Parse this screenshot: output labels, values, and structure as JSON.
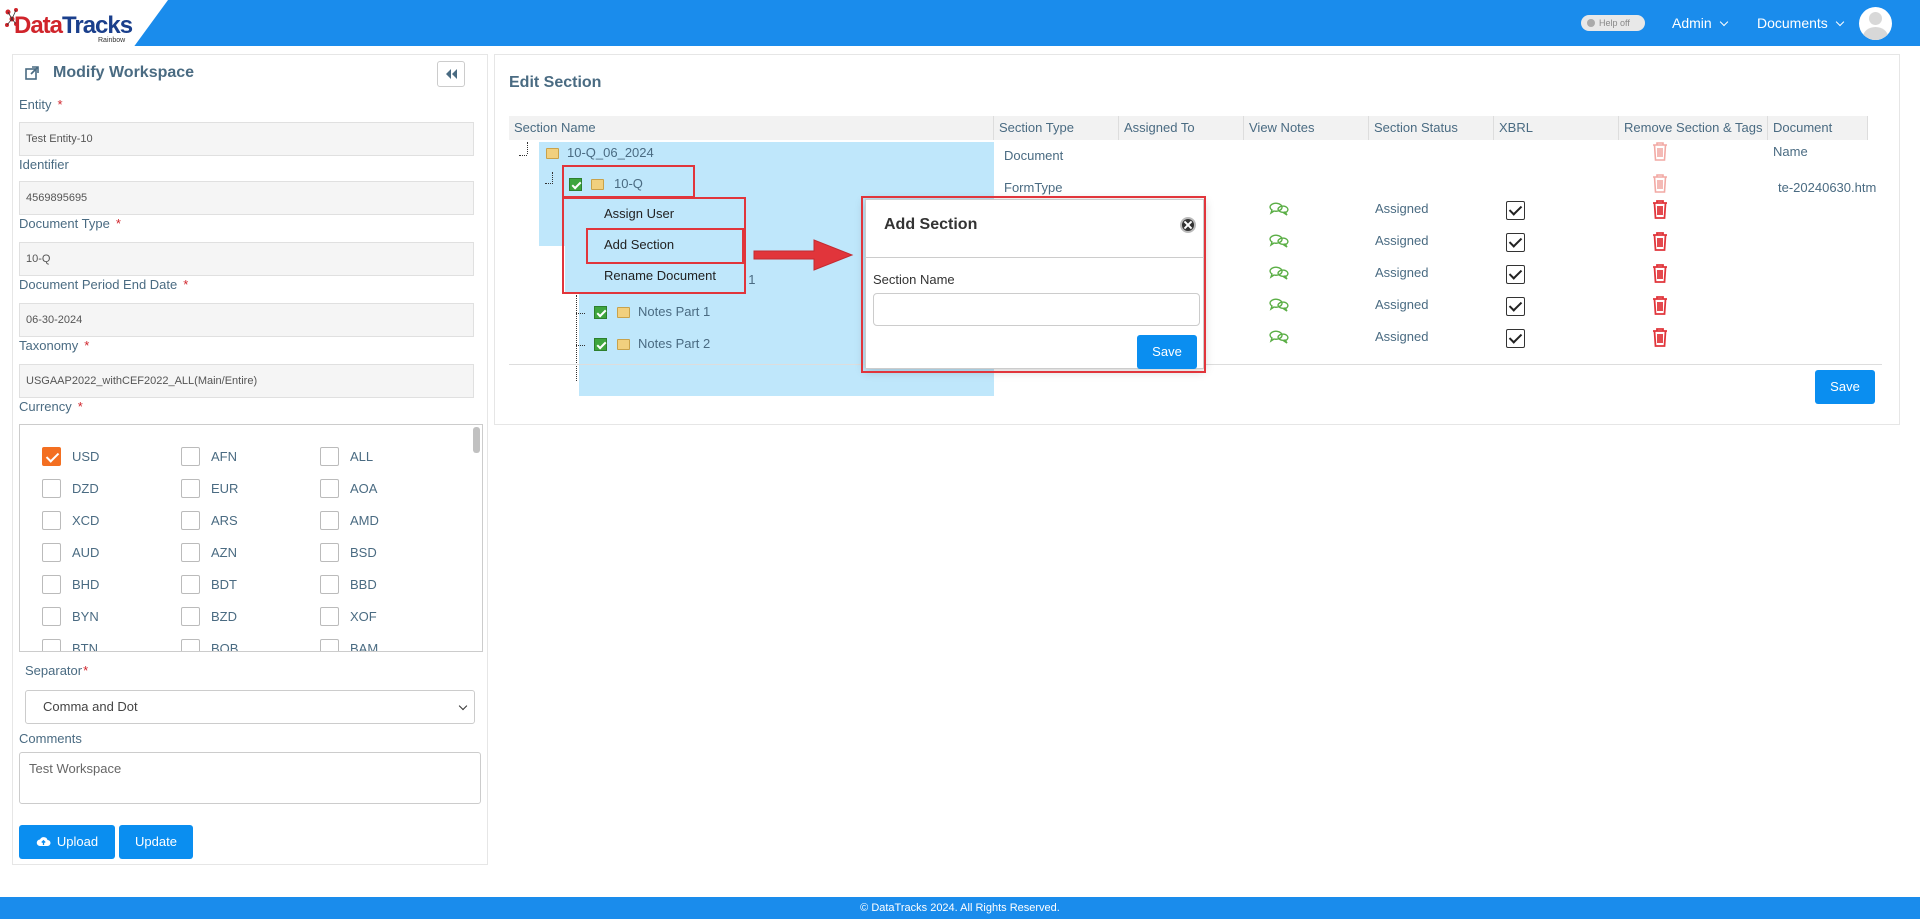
{
  "header": {
    "logo_text_a": "Data",
    "logo_text_b": "Tracks",
    "logo_sub": "Rainbow",
    "help_label": "Help off",
    "nav_admin": "Admin",
    "nav_documents": "Documents"
  },
  "left": {
    "title": "Modify Workspace",
    "entity_label": "Entity",
    "entity_value": "Test Entity-10",
    "identifier_label": "Identifier",
    "identifier_value": "4569895695",
    "doctype_label": "Document Type",
    "doctype_value": "10-Q",
    "period_label": "Document Period End Date",
    "period_value": "06-30-2024",
    "taxonomy_label": "Taxonomy",
    "taxonomy_value": "USGAAP2022_withCEF2022_ALL(Main/Entire)",
    "currency_label": "Currency",
    "currencies": [
      [
        "USD",
        "AFN",
        "ALL"
      ],
      [
        "DZD",
        "EUR",
        "AOA"
      ],
      [
        "XCD",
        "ARS",
        "AMD"
      ],
      [
        "AUD",
        "AZN",
        "BSD"
      ],
      [
        "BHD",
        "BDT",
        "BBD"
      ],
      [
        "BYN",
        "BZD",
        "XOF"
      ],
      [
        "BTN",
        "BOB",
        "BAM"
      ]
    ],
    "checked_currency": "USD",
    "separator_label": "Separator",
    "separator_value": "Comma and Dot",
    "comments_label": "Comments",
    "comments_value": "Test Workspace",
    "upload_label": "Upload",
    "update_label": "Update"
  },
  "right": {
    "title": "Edit Section",
    "columns": [
      "Section Name",
      "Section Type",
      "Assigned To",
      "View Notes",
      "Section Status",
      "XBRL",
      "Remove Section & Tags",
      "Document Name"
    ],
    "rows": [
      {
        "name": "10-Q_06_2024",
        "type": "Document",
        "status": "",
        "doc": ""
      },
      {
        "name": "10-Q",
        "type": "FormType",
        "status": "",
        "doc": "te-20240630.htm"
      },
      {
        "name": "",
        "type": "",
        "status": "Assigned",
        "doc": ""
      },
      {
        "name": "t 1",
        "type": "",
        "status": "Assigned",
        "doc": ""
      },
      {
        "name": "",
        "type": "",
        "status": "Assigned",
        "doc": ""
      },
      {
        "name": "Notes Part 1",
        "type": "",
        "status": "Assigned",
        "doc": ""
      },
      {
        "name": "Notes Part 2",
        "type": "",
        "status": "Assigned",
        "doc": ""
      }
    ],
    "save_label": "Save"
  },
  "context_menu": {
    "items": [
      "Assign User",
      "Add Section",
      "Rename Document"
    ]
  },
  "modal": {
    "title": "Add Section",
    "field_label": "Section Name",
    "field_value": "",
    "save_label": "Save"
  },
  "footer": {
    "text": "© DataTracks 2024. All Rights Reserved."
  },
  "colors": {
    "primary": "#1a8cec",
    "accent_orange": "#f36f21",
    "highlight_red": "#e1353b",
    "tree_highlight": "#bfe7fb"
  }
}
